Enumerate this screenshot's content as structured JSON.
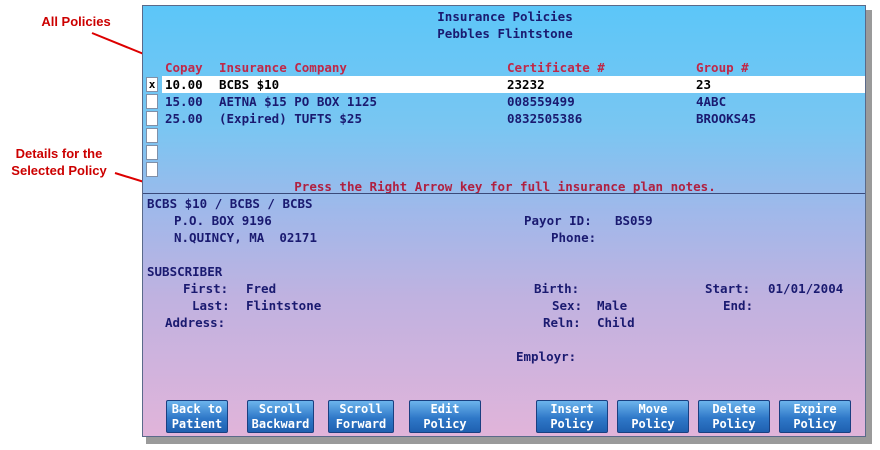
{
  "callouts": {
    "all_policies": "All Policies",
    "details_line1": "Details for the",
    "details_line2": "Selected Policy"
  },
  "screen": {
    "title": "Insurance Policies",
    "patient": "Pebbles Flintstone",
    "columns": {
      "copay": "Copay",
      "company": "Insurance Company",
      "certificate": "Certificate #",
      "group": "Group #"
    },
    "policies": [
      {
        "marker": "x",
        "copay": "10.00",
        "company": "BCBS $10",
        "certificate": "23232",
        "group": "23"
      },
      {
        "marker": "",
        "copay": "15.00",
        "company": "AETNA $15 PO BOX 1125",
        "certificate": "008559499",
        "group": "4ABC"
      },
      {
        "marker": "",
        "copay": "25.00",
        "company": "(Expired) TUFTS $25",
        "certificate": "0832505386",
        "group": "BROOKS45"
      }
    ],
    "hint": "Press the Right Arrow key for full insurance plan notes."
  },
  "details": {
    "plan": "BCBS $10 / BCBS / BCBS",
    "address1": "P.O. BOX 9196",
    "address2": "N.QUINCY, MA  02171",
    "payor_label": "Payor ID:",
    "payor_value": "BS059",
    "phone_label": "Phone:",
    "phone_value": "",
    "subscriber_heading": "SUBSCRIBER",
    "first_label": "First:",
    "first_value": "Fred",
    "last_label": "Last:",
    "last_value": "Flintstone",
    "address_label": "Address:",
    "birth_label": "Birth:",
    "sex_label": "Sex:",
    "sex_value": "Male",
    "reln_label": "Reln:",
    "reln_value": "Child",
    "start_label": "Start:",
    "start_value": "01/01/2004",
    "end_label": "End:",
    "employer_label": "Employr:"
  },
  "buttons": [
    {
      "line1": "Back to",
      "line2": "Patient"
    },
    {
      "line1": "Scroll",
      "line2": "Backward"
    },
    {
      "line1": "Scroll",
      "line2": "Forward"
    },
    {
      "line1": "Edit",
      "line2": "Policy"
    },
    {
      "line1": "Insert",
      "line2": "Policy"
    },
    {
      "line1": "Move",
      "line2": "Policy"
    },
    {
      "line1": "Delete",
      "line2": "Policy"
    },
    {
      "line1": "Expire",
      "line2": "Policy"
    }
  ],
  "colors": {
    "callout_red": "#cc0000",
    "header_red": "#c02848",
    "text_navy": "#1a1a70",
    "button_blue": "#2f78c8"
  }
}
